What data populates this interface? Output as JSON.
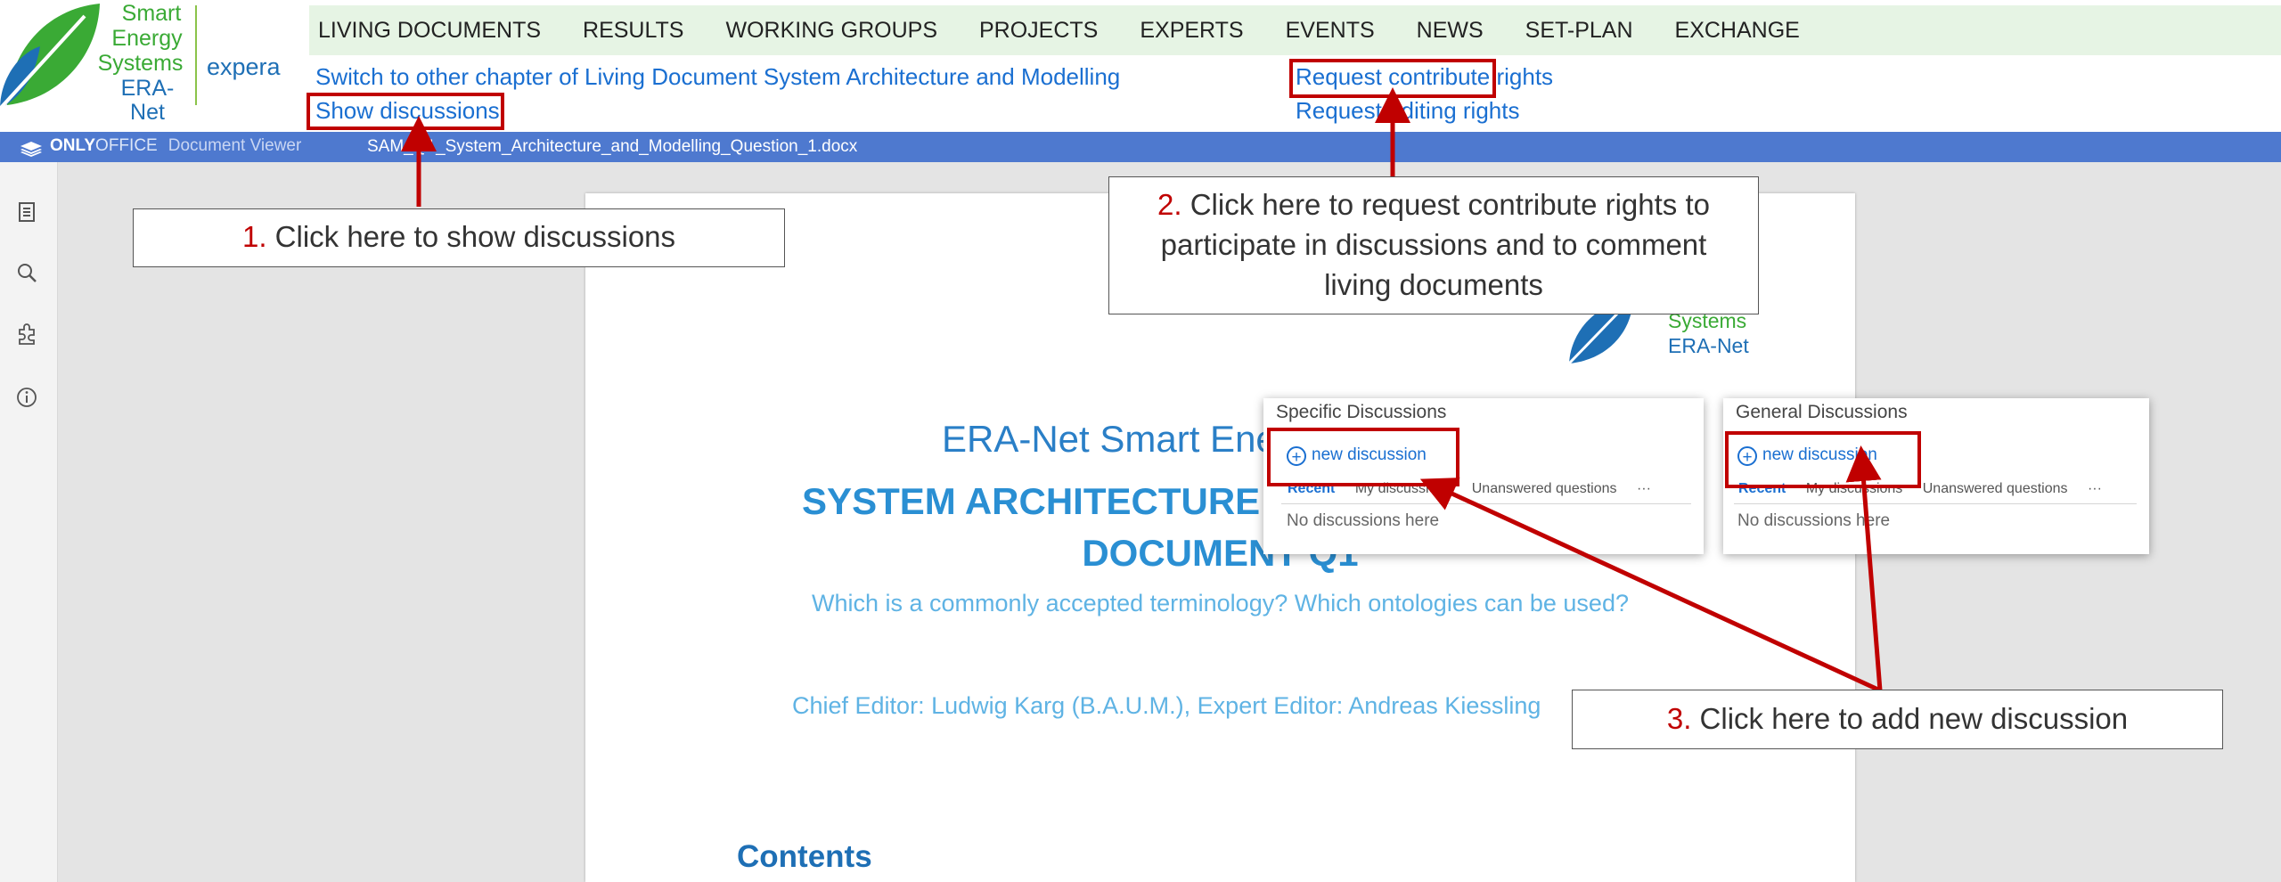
{
  "logo": {
    "line1": "Smart",
    "line2": "Energy",
    "line3": "Systems",
    "line4": "ERA-Net",
    "partner": "expera"
  },
  "nav": {
    "items": [
      "LIVING DOCUMENTS",
      "RESULTS",
      "WORKING GROUPS",
      "PROJECTS",
      "EXPERTS",
      "EVENTS",
      "NEWS",
      "SET-PLAN",
      "EXCHANGE"
    ]
  },
  "links": {
    "switch_chapter": "Switch to other chapter of Living Document System Architecture and Modelling",
    "show_discussions": "Show discussions",
    "request_contribute": "Request contribute rights",
    "request_editing": "Request editing rights"
  },
  "viewer": {
    "brand_bold": "ONLY",
    "brand_light": "OFFICE",
    "mode": "Document Viewer",
    "filename": "SAM_Q1_System_Architecture_and_Modelling_Question_1.docx"
  },
  "document": {
    "logo_systems": "Systems",
    "logo_eranet": "ERA-Net",
    "header": "ERA-Net Smart Energy Systems",
    "title_line1": "SYSTEM ARCHITECTURE AND MODELLING",
    "title_line2": "DOCUMENT Q1",
    "subtitle": "Which is a commonly accepted terminology? Which ontologies can be used?",
    "editors": "Chief Editor: Ludwig Karg (B.A.U.M.), Expert Editor: Andreas Kiessling",
    "contents": "Contents"
  },
  "panels": {
    "specific": {
      "title": "Specific Discussions",
      "new_label": "new discussion",
      "tabs": [
        "Recent",
        "My discussions",
        "Unanswered questions",
        "···"
      ],
      "empty": "No discussions here"
    },
    "general": {
      "title": "General Discussions",
      "new_label": "new discussion",
      "tabs": [
        "Recent",
        "My discussions",
        "Unanswered questions",
        "···"
      ],
      "empty": "No discussions here"
    }
  },
  "callouts": {
    "one_num": "1.",
    "one_text": " Click here to show discussions",
    "two_num": "2.",
    "two_text": " Click here to request contribute rights to participate in discussions and to comment living documents",
    "three_num": "3.",
    "three_text": " Click here to add new discussion"
  },
  "colors": {
    "annotation_red": "#c00000",
    "link_blue": "#1a6fd1",
    "viewer_bar": "#4e79cf",
    "nav_bg": "#e6f4e4",
    "logo_green": "#3aaa35",
    "logo_blue": "#1e6fb5"
  },
  "icons": [
    "leaf-logo-icon",
    "onlyoffice-stack-icon",
    "document-icon",
    "search-icon",
    "plugin-icon",
    "info-icon",
    "plus-circle-icon"
  ]
}
